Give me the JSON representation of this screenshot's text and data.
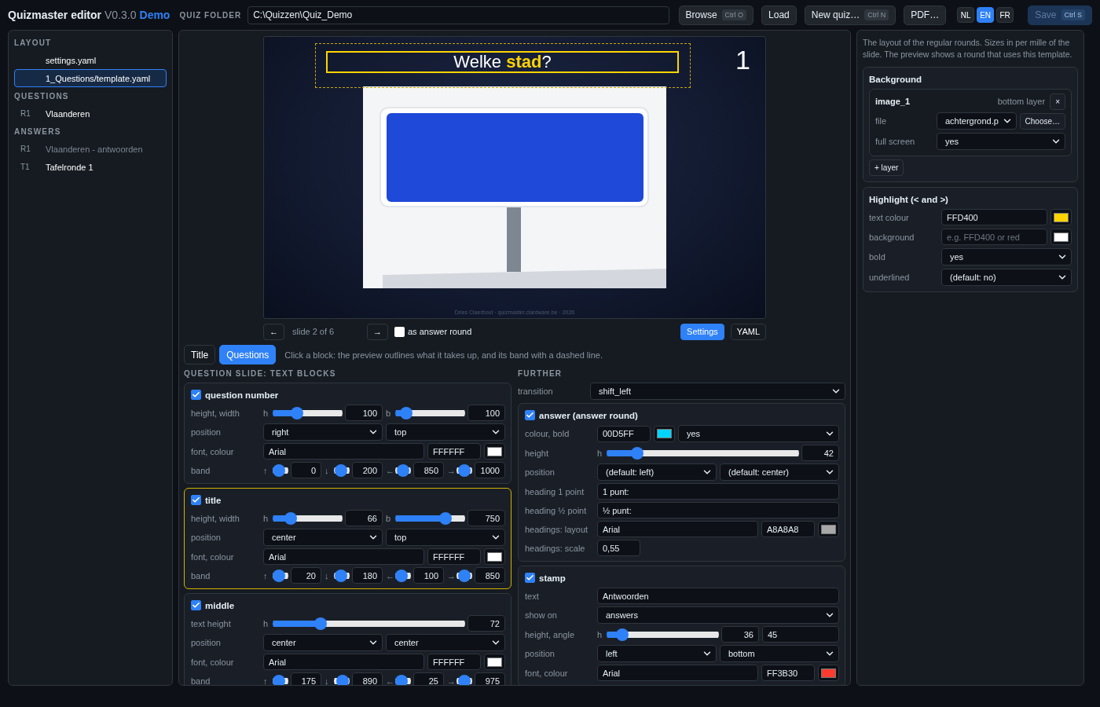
{
  "header": {
    "title": "Quizmaster editor",
    "version": "V0.3.0",
    "edition": "Demo"
  },
  "folder": {
    "label": "QUIZ FOLDER",
    "value": "C:\\Quizzen\\Quiz_Demo"
  },
  "actions": [
    {
      "label": "Browse",
      "shortcut": "Ctrl O"
    },
    {
      "label": "Load"
    },
    {
      "label": "New quiz…",
      "shortcut": "Ctrl N"
    },
    {
      "label": "PDF…"
    }
  ],
  "languages": [
    {
      "label": "NL",
      "selected": false
    },
    {
      "label": "EN",
      "selected": true
    },
    {
      "label": "FR",
      "selected": false
    }
  ],
  "save": {
    "label": "Save",
    "shortcut": "Ctrl S",
    "disabled": true
  },
  "sidebar": [
    {
      "heading": "LAYOUT",
      "items": [
        {
          "label": "settings.yaml",
          "selected": false,
          "disabled": false
        },
        {
          "label": "1_Questions/template.yaml",
          "selected": true,
          "disabled": false
        }
      ]
    },
    {
      "heading": "QUESTIONS",
      "items": [
        {
          "code": "R1",
          "label": "Vlaanderen",
          "selected": false,
          "disabled": false
        }
      ]
    },
    {
      "heading": "ANSWERS",
      "items": [
        {
          "code": "R1",
          "label": "Vlaanderen - antwoorden",
          "selected": false,
          "disabled": true
        },
        {
          "code": "T1",
          "label": "Tafelronde 1",
          "selected": false,
          "disabled": false
        }
      ]
    }
  ],
  "preview": {
    "title": [
      {
        "text": "Welke ",
        "highlight": false
      },
      {
        "text": "stad",
        "highlight": true
      },
      {
        "text": "?",
        "highlight": false
      }
    ],
    "number": "1",
    "credit": "Dries Claerbout · quizmaster.clardware.be · 2026"
  },
  "slide_nav": {
    "prev": "←",
    "position": "slide 2 of 6",
    "next": "→",
    "answer_round": {
      "label": "as answer round",
      "checked": false
    }
  },
  "views": [
    {
      "label": "Settings",
      "selected": true
    },
    {
      "label": "YAML",
      "selected": false
    }
  ],
  "tabs": [
    {
      "label": "Title",
      "selected": false
    },
    {
      "label": "Questions",
      "selected": true
    }
  ],
  "hint": "Click a block: the preview outlines what it takes up, and its band with a dashed line.",
  "text_blocks": {
    "heading": "QUESTION SLIDE: TEXT BLOCKS",
    "blocks": [
      {
        "name": "question number",
        "checked": true,
        "selected": false,
        "rows": [
          {
            "label": "height, width",
            "fields": [
              {
                "kind": "slider",
                "prefix": "h",
                "level": 0.35,
                "value": "100"
              },
              {
                "kind": "slider",
                "prefix": "b",
                "level": 0.16,
                "value": "100"
              }
            ]
          },
          {
            "label": "position",
            "fields": [
              {
                "kind": "select",
                "value": "right"
              },
              {
                "kind": "select",
                "value": "top"
              }
            ]
          },
          {
            "label": "font, colour",
            "fields": [
              {
                "kind": "text",
                "value": "Arial"
              },
              {
                "kind": "hex",
                "value": "FFFFFF"
              },
              {
                "kind": "swatch",
                "color": "#ffffff"
              }
            ]
          },
          {
            "label": "band",
            "fields": [
              {
                "kind": "mini",
                "prefix": "↑",
                "level": 0,
                "value": "0"
              },
              {
                "kind": "mini",
                "prefix": "↓",
                "level": 0.2,
                "value": "200"
              },
              {
                "kind": "mini",
                "prefix": "←",
                "level": 0.5,
                "value": "850"
              },
              {
                "kind": "mini",
                "prefix": "→",
                "level": 0.5,
                "value": "1000"
              }
            ]
          }
        ]
      },
      {
        "name": "title",
        "checked": true,
        "selected": true,
        "rows": [
          {
            "label": "height, width",
            "fields": [
              {
                "kind": "slider",
                "prefix": "h",
                "level": 0.26,
                "value": "66"
              },
              {
                "kind": "slider",
                "prefix": "b",
                "level": 0.72,
                "value": "750"
              }
            ]
          },
          {
            "label": "position",
            "fields": [
              {
                "kind": "select",
                "value": "center"
              },
              {
                "kind": "select",
                "value": "top"
              }
            ]
          },
          {
            "label": "font, colour",
            "fields": [
              {
                "kind": "text",
                "value": "Arial"
              },
              {
                "kind": "hex",
                "value": "FFFFFF"
              },
              {
                "kind": "swatch",
                "color": "#ffffff"
              }
            ]
          },
          {
            "label": "band",
            "fields": [
              {
                "kind": "mini",
                "prefix": "↑",
                "level": 0,
                "value": "20"
              },
              {
                "kind": "mini",
                "prefix": "↓",
                "level": 0.2,
                "value": "180"
              },
              {
                "kind": "mini",
                "prefix": "←",
                "level": 0.1,
                "value": "100"
              },
              {
                "kind": "mini",
                "prefix": "→",
                "level": 0.5,
                "value": "850"
              }
            ]
          }
        ]
      },
      {
        "name": "middle",
        "checked": true,
        "selected": false,
        "rows": [
          {
            "label": "text height",
            "fields": [
              {
                "kind": "slider",
                "prefix": "h",
                "level": 0.25,
                "value": "72"
              }
            ]
          },
          {
            "label": "position",
            "fields": [
              {
                "kind": "select",
                "value": "center"
              },
              {
                "kind": "select",
                "value": "center"
              }
            ]
          },
          {
            "label": "font, colour",
            "fields": [
              {
                "kind": "text",
                "value": "Arial"
              },
              {
                "kind": "hex",
                "value": "FFFFFF"
              },
              {
                "kind": "swatch",
                "color": "#ffffff"
              }
            ]
          },
          {
            "label": "band",
            "fields": [
              {
                "kind": "mini",
                "prefix": "↑",
                "level": 0,
                "value": "175"
              },
              {
                "kind": "mini",
                "prefix": "↓",
                "level": 0.8,
                "value": "890"
              },
              {
                "kind": "mini",
                "prefix": "←",
                "level": 0.1,
                "value": "25"
              },
              {
                "kind": "mini",
                "prefix": "→",
                "level": 0.5,
                "value": "975"
              }
            ]
          }
        ]
      }
    ]
  },
  "further": {
    "heading": "FURTHER",
    "rows": [
      {
        "label": "transition",
        "fields": [
          {
            "kind": "select",
            "value": "shift_left"
          }
        ]
      }
    ],
    "blocks": [
      {
        "name": "answer (answer round)",
        "checked": true,
        "selected": false,
        "rows": [
          {
            "label": "colour, bold",
            "fields": [
              {
                "kind": "hex",
                "value": "00D5FF"
              },
              {
                "kind": "swatch",
                "color": "#00d5ff"
              },
              {
                "kind": "select",
                "value": "yes"
              }
            ]
          },
          {
            "label": "height",
            "fields": [
              {
                "kind": "slider",
                "prefix": "h",
                "level": 0.16,
                "value": "42"
              }
            ]
          },
          {
            "label": "position",
            "fields": [
              {
                "kind": "select",
                "value": "(default: left)"
              },
              {
                "kind": "select",
                "value": "(default: center)"
              }
            ]
          },
          {
            "label": "heading 1 point",
            "fields": [
              {
                "kind": "text",
                "value": "1 punt:"
              }
            ]
          },
          {
            "label": "heading ½ point",
            "fields": [
              {
                "kind": "text",
                "value": "½ punt:"
              }
            ]
          },
          {
            "label": "headings: layout",
            "fields": [
              {
                "kind": "text",
                "value": "Arial"
              },
              {
                "kind": "hex",
                "value": "A8A8A8"
              },
              {
                "kind": "swatch",
                "color": "#a8a8a8"
              }
            ]
          },
          {
            "label": "headings: scale",
            "fields": [
              {
                "kind": "short",
                "value": "0,55"
              }
            ]
          }
        ]
      },
      {
        "name": "stamp",
        "checked": true,
        "selected": false,
        "rows": [
          {
            "label": "text",
            "fields": [
              {
                "kind": "text",
                "value": "Antwoorden"
              }
            ]
          },
          {
            "label": "show on",
            "fields": [
              {
                "kind": "select",
                "value": "answers"
              }
            ]
          },
          {
            "label": "height, angle",
            "fields": [
              {
                "kind": "slider",
                "prefix": "h",
                "level": 0.14,
                "value": "36"
              },
              {
                "kind": "angle",
                "value": "45"
              }
            ]
          },
          {
            "label": "position",
            "fields": [
              {
                "kind": "select",
                "value": "left"
              },
              {
                "kind": "select",
                "value": "bottom"
              }
            ]
          },
          {
            "label": "font, colour",
            "fields": [
              {
                "kind": "text",
                "value": "Arial"
              },
              {
                "kind": "hex",
                "value": "FF3B30"
              },
              {
                "kind": "swatch",
                "color": "#ff3b30"
              }
            ]
          }
        ]
      }
    ]
  },
  "template": {
    "description": "The layout of the regular rounds. Sizes in per mille of the slide. The preview shows a round that uses this template.",
    "background": {
      "heading": "Background",
      "layers": [
        {
          "name": "image_1",
          "position": "bottom layer",
          "remove": "×",
          "rows": [
            {
              "label": "file",
              "fields": [
                {
                  "kind": "select",
                  "value": "achtergrond.p"
                },
                {
                  "kind": "button",
                  "value": "Choose…"
                }
              ]
            },
            {
              "label": "full screen",
              "fields": [
                {
                  "kind": "select",
                  "value": "yes"
                }
              ]
            }
          ]
        }
      ],
      "add": "+ layer"
    },
    "highlight": {
      "heading": "Highlight (< and >)",
      "rows": [
        {
          "label": "text colour",
          "fields": [
            {
              "kind": "text",
              "value": "FFD400"
            },
            {
              "kind": "swatch",
              "color": "#ffd400"
            }
          ]
        },
        {
          "label": "background",
          "fields": [
            {
              "kind": "text",
              "placeholder": "e.g. FFD400 or red"
            },
            {
              "kind": "swatch",
              "color": "#ffffff"
            }
          ]
        },
        {
          "label": "bold",
          "fields": [
            {
              "kind": "select",
              "value": "yes"
            }
          ]
        },
        {
          "label": "underlined",
          "fields": [
            {
              "kind": "select",
              "value": "(default: no)"
            }
          ]
        }
      ]
    }
  }
}
